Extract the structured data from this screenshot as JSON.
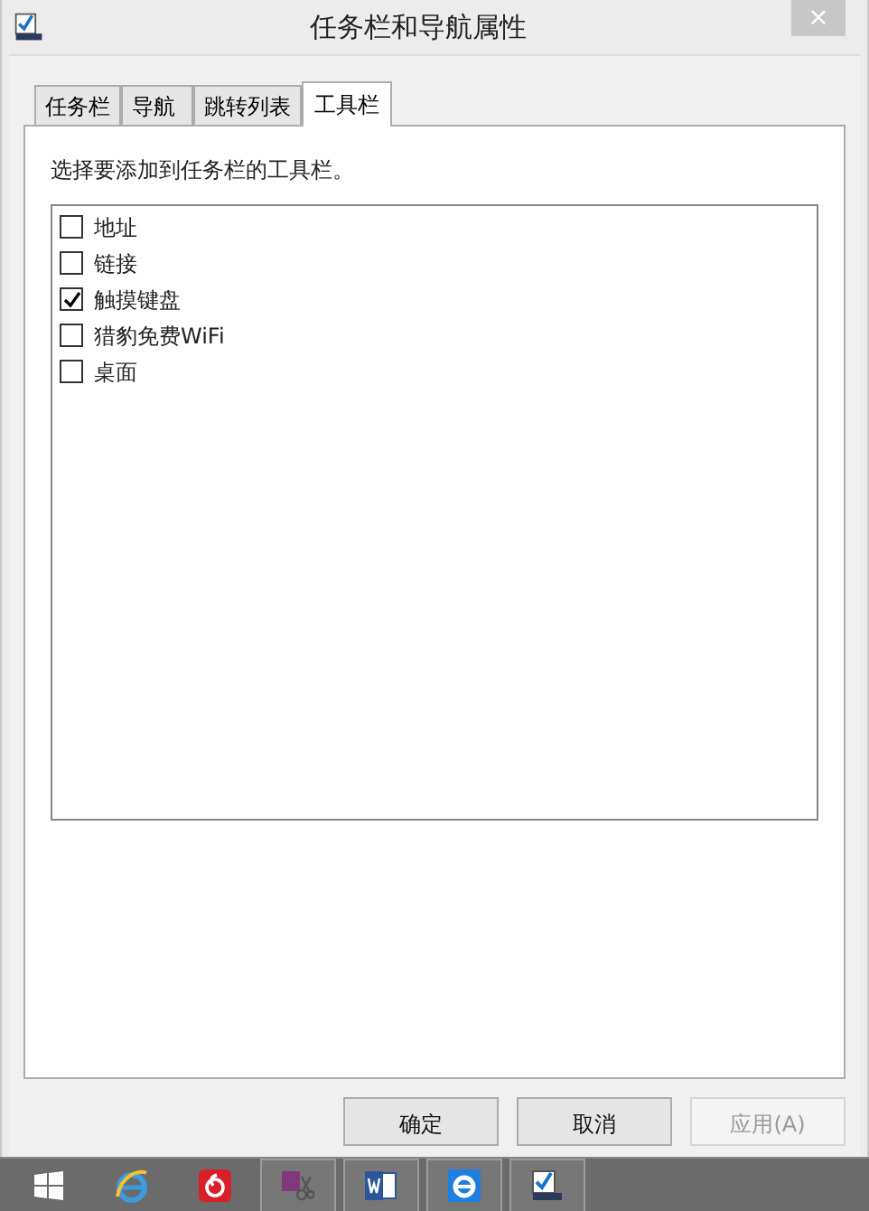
{
  "window": {
    "title": "任务栏和导航属性",
    "close": "×"
  },
  "tabs": [
    {
      "label": "任务栏",
      "selected": false
    },
    {
      "label": "导航",
      "selected": false
    },
    {
      "label": "跳转列表",
      "selected": false
    },
    {
      "label": "工具栏",
      "selected": true
    }
  ],
  "instruction": "选择要添加到任务栏的工具栏。",
  "toolbars": [
    {
      "label": "地址",
      "checked": false
    },
    {
      "label": "链接",
      "checked": false
    },
    {
      "label": "触摸键盘",
      "checked": true
    },
    {
      "label": "猎豹免费WiFi",
      "checked": false
    },
    {
      "label": "桌面",
      "checked": false
    }
  ],
  "buttons": [
    {
      "label": "确定",
      "disabled": false
    },
    {
      "label": "取消",
      "disabled": false
    },
    {
      "label": "应用(A)",
      "disabled": true
    }
  ],
  "taskbar": [
    {
      "kind": "start",
      "running": false
    },
    {
      "kind": "ie",
      "running": false
    },
    {
      "kind": "music",
      "running": false
    },
    {
      "kind": "onenote",
      "running": true
    },
    {
      "kind": "word",
      "running": true
    },
    {
      "kind": "ie2",
      "running": true
    },
    {
      "kind": "app",
      "running": true
    }
  ]
}
